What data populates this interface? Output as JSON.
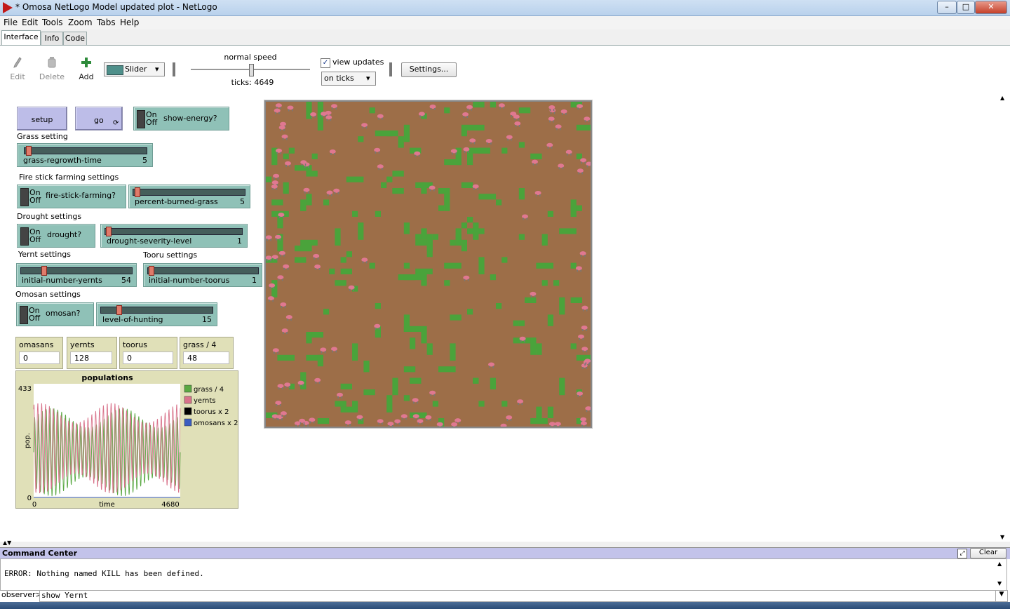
{
  "window": {
    "title": "* Omosa NetLogo Model updated plot - NetLogo",
    "controls": {
      "minimize": "–",
      "maximize": "□",
      "close": "✕"
    }
  },
  "menubar": [
    "File",
    "Edit",
    "Tools",
    "Zoom",
    "Tabs",
    "Help"
  ],
  "tabs": [
    "Interface",
    "Info",
    "Code"
  ],
  "toolbar": {
    "edit_label": "Edit",
    "delete_label": "Delete",
    "add_label": "Add",
    "widget_type": "Slider",
    "speed_label": "normal speed",
    "speed_fraction": 0.5,
    "ticks_label": "ticks: 4649",
    "view_updates_label": "view updates",
    "view_updates_checked": true,
    "update_mode": "on ticks",
    "settings_label": "Settings..."
  },
  "widgets": {
    "setup_label": "setup",
    "go_label": "go",
    "go_forever_icon": "forever-arrows-icon",
    "show_energy": {
      "on": "On",
      "off": "Off",
      "label": "show-energy?"
    },
    "grass_header": "Grass setting",
    "grass_regrowth": {
      "label": "grass-regrowth-time",
      "value": "5",
      "fraction": 0.02
    },
    "fire_header": "Fire stick farming settings",
    "fire_stick": {
      "on": "On",
      "off": "Off",
      "label": "fire-stick-farming?"
    },
    "percent_burned": {
      "label": "percent-burned-grass",
      "value": "5",
      "fraction": 0.02
    },
    "drought_header": "Drought settings",
    "drought": {
      "on": "On",
      "off": "Off",
      "label": "drought?"
    },
    "drought_severity": {
      "label": "drought-severity-level",
      "value": "1",
      "fraction": 0.01
    },
    "yernt_header": "Yernt settings",
    "tooru_header": "Tooru settings",
    "initial_yernts": {
      "label": "initial-number-yernts",
      "value": "54",
      "fraction": 0.2
    },
    "initial_toorus": {
      "label": "initial-number-toorus",
      "value": "1",
      "fraction": 0.01
    },
    "omosan_header": "Omosan settings",
    "omosan": {
      "on": "On",
      "off": "Off",
      "label": "omosan?"
    },
    "level_hunting": {
      "label": "level-of-hunting",
      "value": "15",
      "fraction": 0.15
    },
    "monitors": [
      {
        "label": "omasans",
        "value": "0"
      },
      {
        "label": "yernts",
        "value": "128"
      },
      {
        "label": "toorus",
        "value": "0"
      },
      {
        "label": "grass / 4",
        "value": "48"
      }
    ]
  },
  "chart_data": {
    "type": "line",
    "title": "populations",
    "xlabel": "time",
    "ylabel": "pop.",
    "xlim": [
      0,
      4680
    ],
    "ylim": [
      0,
      433
    ],
    "x_tick_labels": [
      "0",
      "4680"
    ],
    "y_tick_labels": [
      "0",
      "433"
    ],
    "legend_position": "right",
    "series": [
      {
        "name": "grass / 4",
        "color": "#59a842",
        "pattern": "oscillating",
        "low": 5,
        "high": 340,
        "cycles": 38
      },
      {
        "name": "yernts",
        "color": "#d8728a",
        "pattern": "oscillating",
        "low": 15,
        "high": 360,
        "cycles": 38
      },
      {
        "name": "toorus x 2",
        "color": "#000000",
        "pattern": "flat",
        "value": 0
      },
      {
        "name": "omosans x 2",
        "color": "#3a5cc0",
        "pattern": "flat",
        "value": 0
      }
    ]
  },
  "world_view": {
    "background_color": "#9d6e48",
    "grass_color": "#4aa33b",
    "agent_color": "#e07891",
    "grass_patch_count": 180,
    "agent_count": 128
  },
  "command_center": {
    "title": "Command Center",
    "clear_label": "Clear",
    "output": "ERROR: Nothing named KILL has been defined.",
    "prompt": "observer>",
    "input_value": "show Yernt"
  }
}
